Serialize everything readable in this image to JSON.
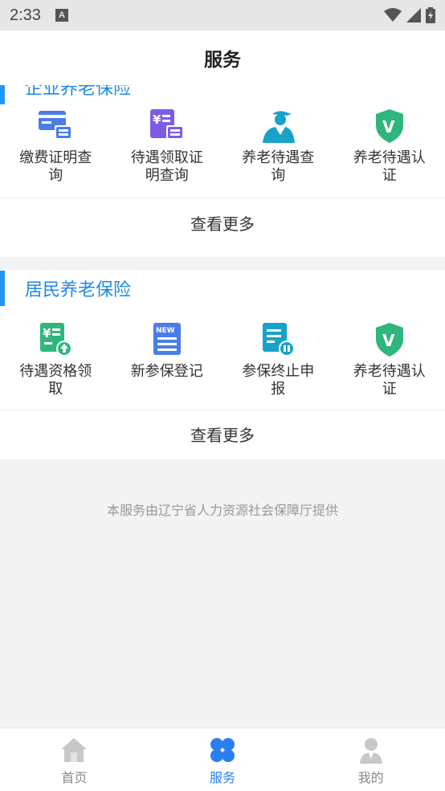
{
  "status_bar": {
    "time": "2:33",
    "notification_icon": "A"
  },
  "header": {
    "title": "服务"
  },
  "sections": [
    {
      "title": "企业养老保险",
      "items": [
        {
          "label": "缴费证明查询",
          "icon": "payment-certificate-icon"
        },
        {
          "label": "待遇领取证明查询",
          "icon": "yuan-certificate-icon"
        },
        {
          "label": "养老待遇查询",
          "icon": "worker-icon"
        },
        {
          "label": "养老待遇认证",
          "icon": "verify-shield-icon"
        }
      ],
      "more_label": "查看更多"
    },
    {
      "title": "居民养老保险",
      "items": [
        {
          "label": "待遇资格领取",
          "icon": "yuan-upload-icon"
        },
        {
          "label": "新参保登记",
          "icon": "new-document-icon"
        },
        {
          "label": "参保终止申报",
          "icon": "pause-document-icon"
        },
        {
          "label": "养老待遇认证",
          "icon": "verify-shield-icon"
        }
      ],
      "more_label": "查看更多"
    }
  ],
  "footer_note": "本服务由辽宁省人力资源社会保障厅提供",
  "tabs": [
    {
      "label": "首页",
      "icon": "home-icon",
      "active": false
    },
    {
      "label": "服务",
      "icon": "clover-icon",
      "active": true
    },
    {
      "label": "我的",
      "icon": "profile-icon",
      "active": false
    }
  ],
  "colors": {
    "accent": "#2196f3",
    "tab_active": "#2a7ff0",
    "green": "#2eb67d",
    "blue": "#4a7de6",
    "purple": "#7c5ce6",
    "teal": "#17a2c8"
  }
}
